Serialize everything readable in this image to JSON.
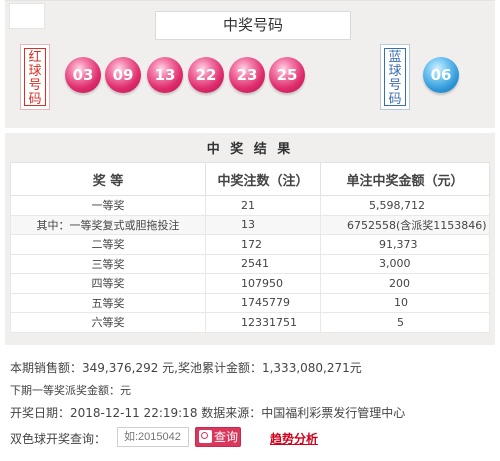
{
  "header": {
    "title": "中奖号码",
    "red_label": "红球号码",
    "blue_label": "蓝球号码"
  },
  "balls": {
    "red": [
      "03",
      "09",
      "13",
      "22",
      "23",
      "25"
    ],
    "blue": [
      "06"
    ]
  },
  "results": {
    "title": "中 奖 结 果",
    "columns": [
      "奖 等",
      "中奖注数（注）",
      "单注中奖金额（元）"
    ],
    "rows": [
      {
        "prize": "一等奖",
        "count": "21",
        "amount": "5,598,712"
      },
      {
        "prize": "其中：一等奖复式或胆拖投注",
        "count": "13",
        "amount": "6752558(含派奖1153846)"
      },
      {
        "prize": "二等奖",
        "count": "172",
        "amount": "91,373"
      },
      {
        "prize": "三等奖",
        "count": "2541",
        "amount": "3,000"
      },
      {
        "prize": "四等奖",
        "count": "107950",
        "amount": "200"
      },
      {
        "prize": "五等奖",
        "count": "1745779",
        "amount": "10"
      },
      {
        "prize": "六等奖",
        "count": "12331751",
        "amount": "5"
      }
    ]
  },
  "info": {
    "sales": "本期销售额：349,376,292 元,奖池累计金额：1,333,080,271元",
    "dispatch": "下期一等奖派奖金额：元",
    "draw": "开奖日期：2018-12-11 22:19:18  数据来源：中国福利彩票发行管理中心"
  },
  "query": {
    "label": "双色球开奖查询：",
    "placeholder": "如:2015042",
    "button": "查询",
    "trend_link": "趋势分析"
  },
  "colors": {
    "red_ball": "#de2b6b",
    "blue_ball": "#2f98d9",
    "accent_red": "#d93025",
    "accent_blue": "#3b6db3"
  }
}
